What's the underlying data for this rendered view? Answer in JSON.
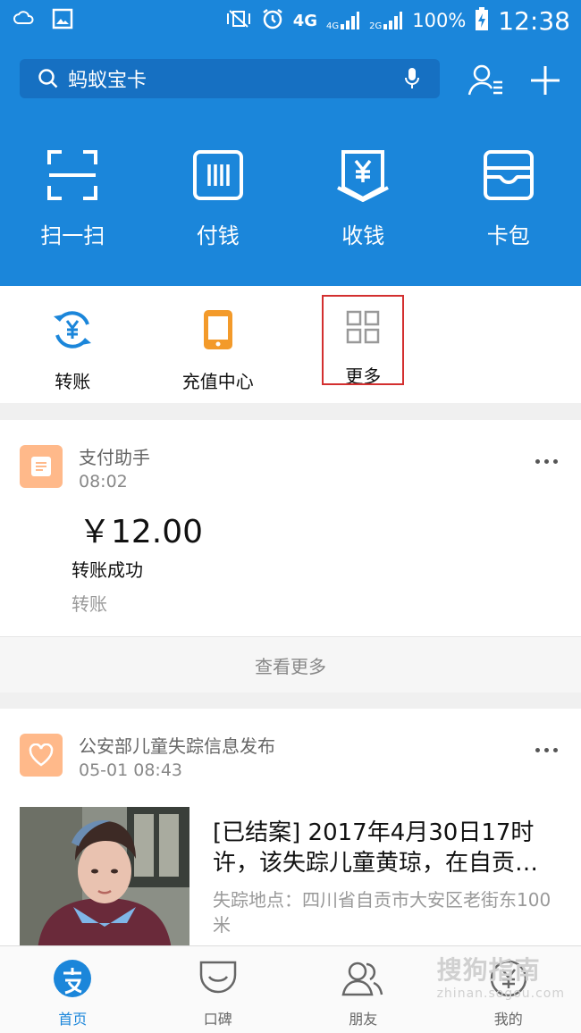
{
  "status_bar": {
    "network_4g": "4G",
    "network_4g_small": "4G",
    "network_2g_small": "2G",
    "battery": "100%",
    "time": "12:38"
  },
  "search": {
    "value": "蚂蚁宝卡"
  },
  "quick_actions": [
    {
      "label": "扫一扫",
      "icon": "scan-icon"
    },
    {
      "label": "付钱",
      "icon": "barcode-icon"
    },
    {
      "label": "收钱",
      "icon": "yuan-receive-icon"
    },
    {
      "label": "卡包",
      "icon": "card-wallet-icon"
    }
  ],
  "shortcuts": [
    {
      "label": "转账",
      "icon": "transfer-icon"
    },
    {
      "label": "充值中心",
      "icon": "phone-topup-icon"
    },
    {
      "label": "更多",
      "icon": "grid-more-icon"
    }
  ],
  "payment_card": {
    "app_name": "支付助手",
    "time": "08:02",
    "amount": "￥12.00",
    "status": "转账成功",
    "type": "转账",
    "see_more": "查看更多"
  },
  "news_card": {
    "app_name": "公安部儿童失踪信息发布",
    "time": "05-01 08:43",
    "title": "[已结案] 2017年4月30日17时许，该失踪儿童黄琼，在自贡…",
    "location": "失踪地点：四川省自贡市大安区老街东100米"
  },
  "tabbar": [
    {
      "label": "首页",
      "icon": "alipay-home-icon",
      "active": true
    },
    {
      "label": "口碑",
      "icon": "koubei-icon"
    },
    {
      "label": "朋友",
      "icon": "friends-icon"
    },
    {
      "label": "我的",
      "icon": "my-wealth-icon"
    }
  ],
  "watermark": {
    "text": "搜狗指南",
    "sub": "zhinan.sogou.com"
  },
  "colors": {
    "brand_blue": "#1b86da",
    "highlight_red": "#d32f2f",
    "app_orange": "#ffb98a"
  }
}
